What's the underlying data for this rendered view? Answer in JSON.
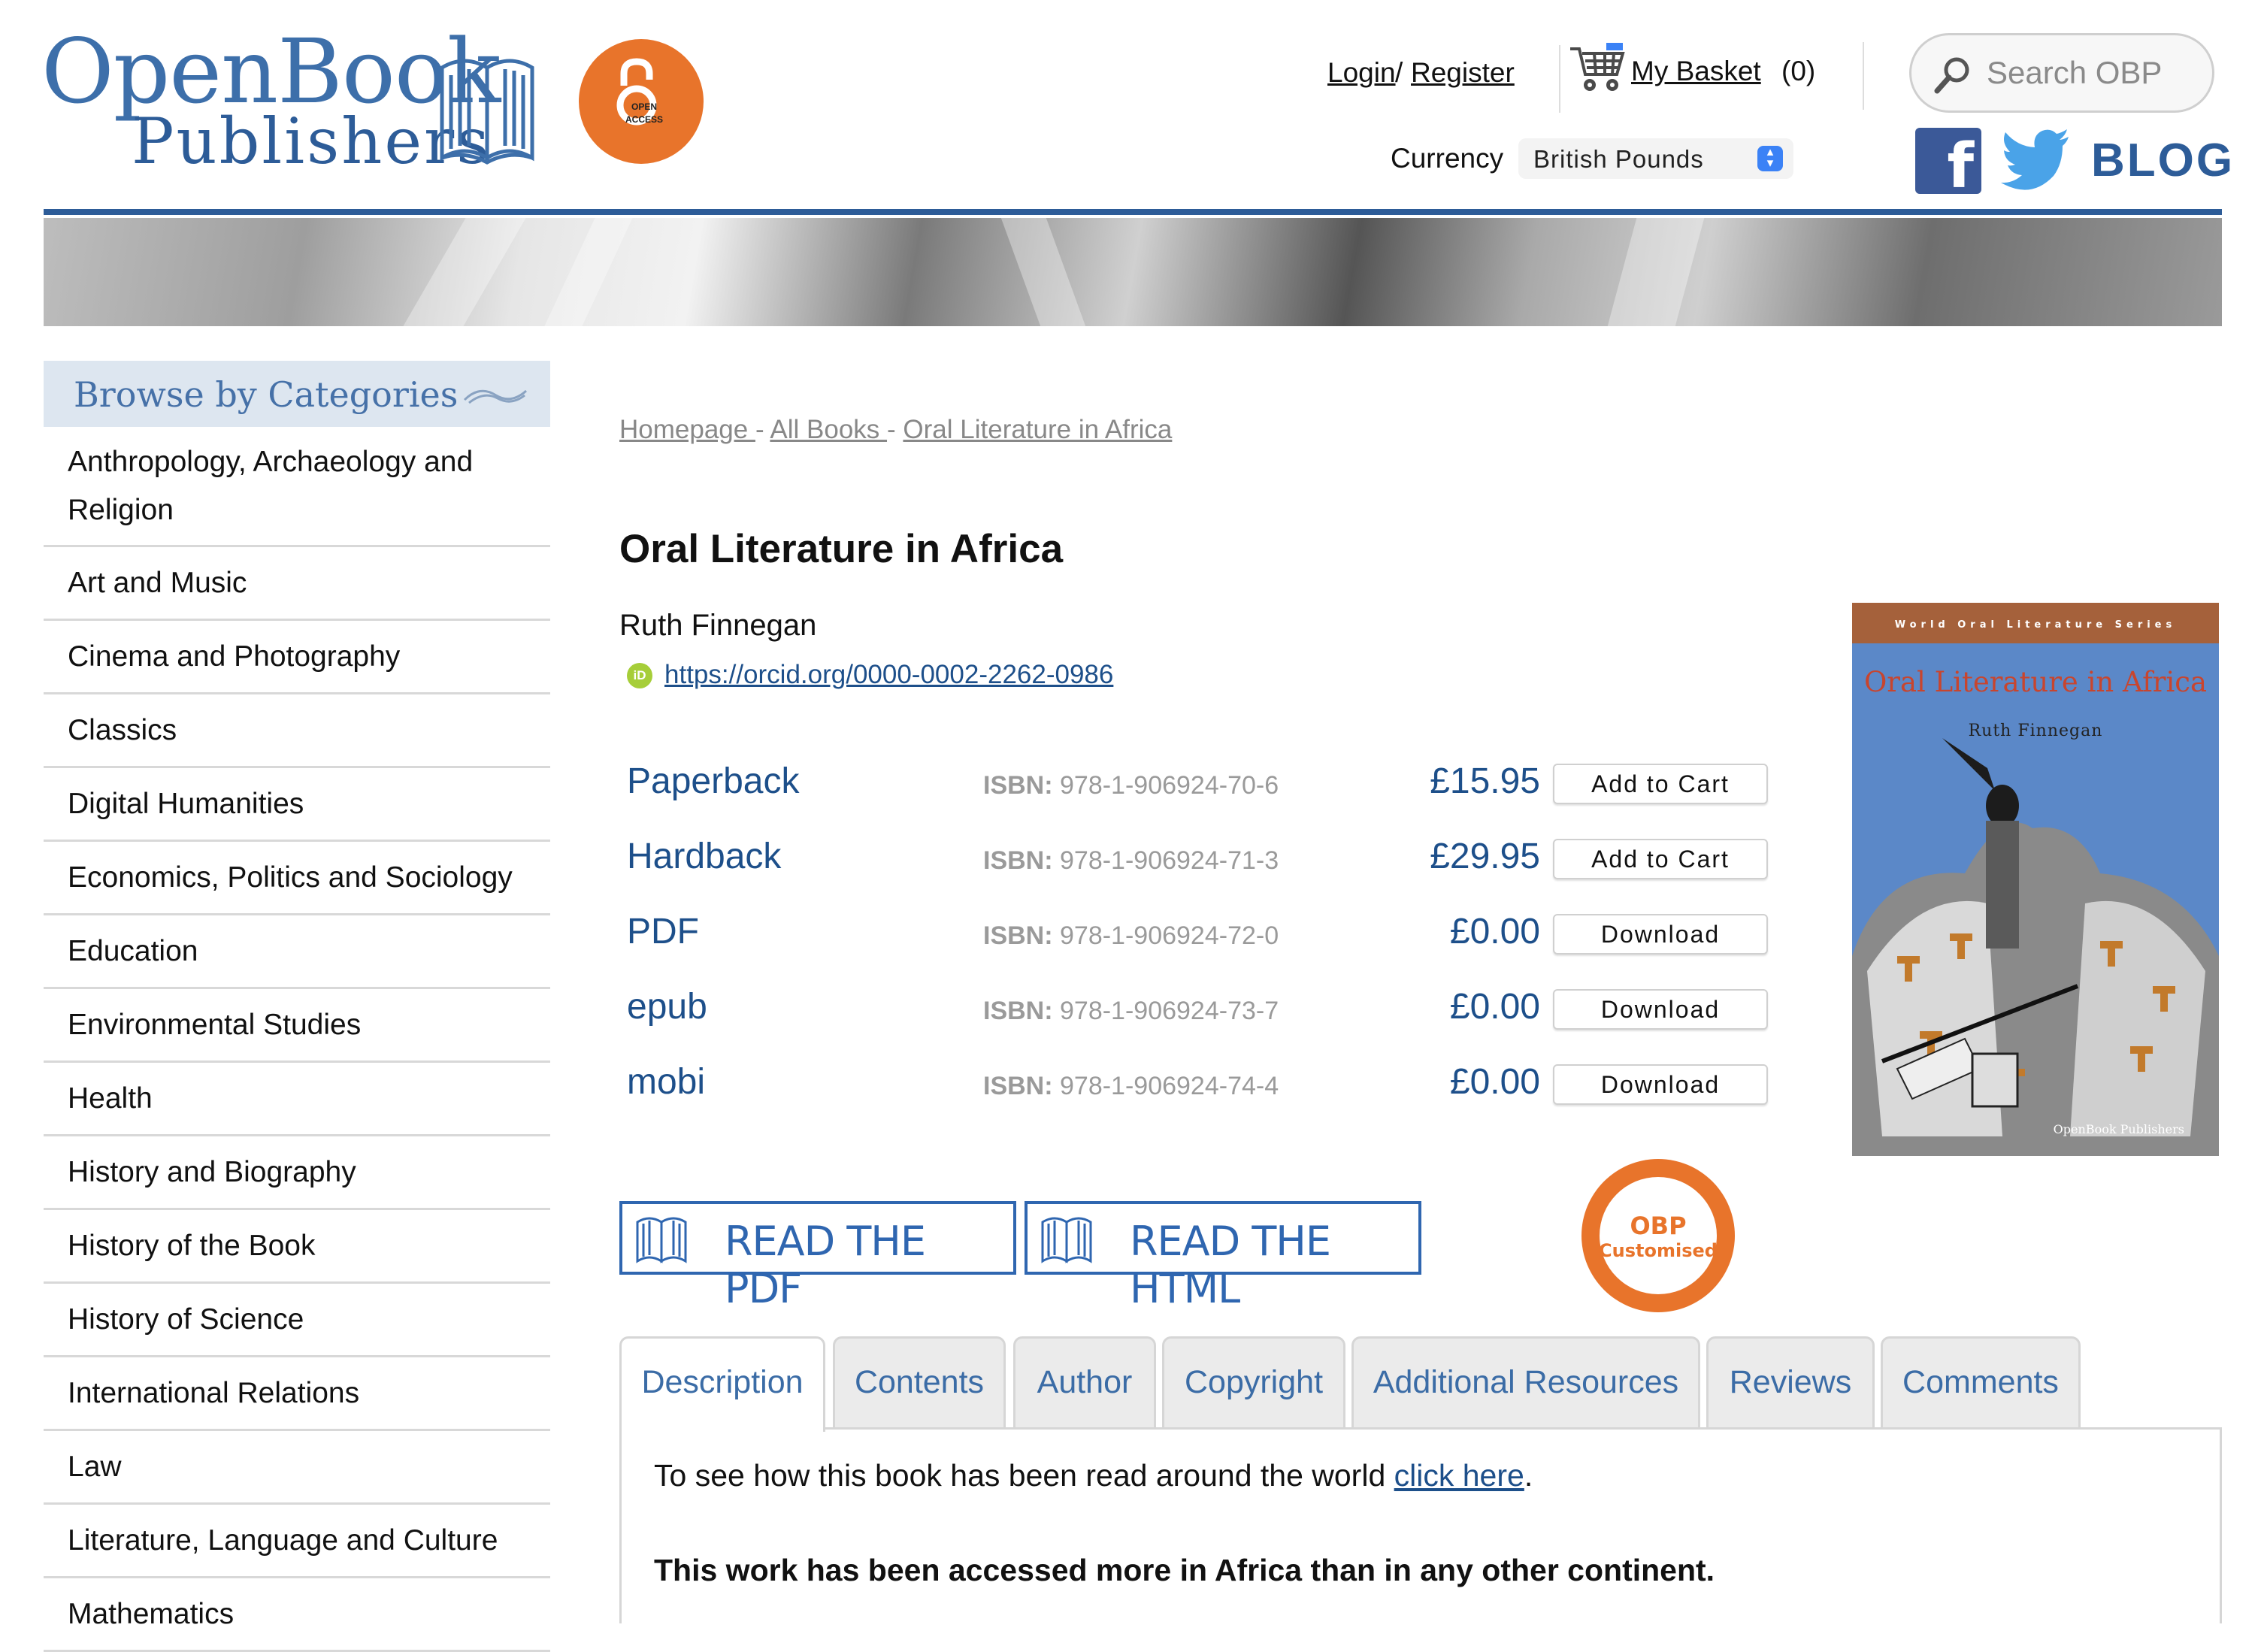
{
  "brand": {
    "name_line1": "OpenBook",
    "name_line2": "Publishers",
    "oa_badge_text_1": "OPEN",
    "oa_badge_text_2": "ACCESS"
  },
  "header": {
    "login": "Login",
    "login_sep": "/",
    "register": "Register",
    "basket_label": "My Basket",
    "basket_count": "(0)",
    "currency_label": "Currency",
    "currency_value": "British Pounds",
    "search_placeholder": "Search OBP",
    "blog_label": "BLOG"
  },
  "sidebar": {
    "title": "Browse by Categories",
    "items": [
      "Anthropology, Archaeology and Religion",
      "Art and Music",
      "Cinema and Photography",
      "Classics",
      "Digital Humanities",
      "Economics, Politics and Sociology",
      "Education",
      "Environmental Studies",
      "Health",
      "History and Biography",
      "History of the Book",
      "History of Science",
      "International Relations",
      "Law",
      "Literature, Language and Culture",
      "Mathematics"
    ]
  },
  "breadcrumb": {
    "home": "Homepage ",
    "sep1": " - ",
    "all_books": "All Books ",
    "sep2": " - ",
    "current": "Oral Literature in Africa"
  },
  "book": {
    "title": "Oral Literature in Africa",
    "author": "Ruth Finnegan",
    "orcid_icon": "iD",
    "orcid_url": "https://orcid.org/0000-0002-2262-0986",
    "formats": [
      {
        "name": "Paperback",
        "isbn_label": "ISBN:",
        "isbn": " 978-1-906924-70-6",
        "price": "£15.95",
        "action": "Add to Cart"
      },
      {
        "name": "Hardback",
        "isbn_label": "ISBN:",
        "isbn": " 978-1-906924-71-3",
        "price": "£29.95",
        "action": "Add to Cart"
      },
      {
        "name": "PDF",
        "isbn_label": "ISBN:",
        "isbn": " 978-1-906924-72-0",
        "price": "£0.00",
        "action": "Download"
      },
      {
        "name": "epub",
        "isbn_label": "ISBN:",
        "isbn": " 978-1-906924-73-7",
        "price": "£0.00",
        "action": "Download"
      },
      {
        "name": "mobi",
        "isbn_label": "ISBN:",
        "isbn": " 978-1-906924-74-4",
        "price": "£0.00",
        "action": "Download"
      }
    ],
    "cover": {
      "series": "World Oral Literature Series",
      "title": "Oral Literature in Africa",
      "author": "Ruth Finnegan",
      "publisher": "OpenBook Publishers"
    }
  },
  "actions": {
    "read_pdf": "READ THE PDF",
    "read_html": "READ THE HTML",
    "customised_1": "OBP",
    "customised_2": "Customised"
  },
  "tabs": [
    "Description",
    "Contents",
    "Author",
    "Copyright",
    "Additional Resources",
    "Reviews",
    "Comments"
  ],
  "description": {
    "line1_prefix": "To see how this book has been read around the world ",
    "line1_link": "click here",
    "line1_suffix": ".",
    "line2": "This work has been accessed more in Africa than in any other continent."
  },
  "colors": {
    "brand_blue": "#2d5c98",
    "link_blue": "#1d4f8a",
    "accent_orange": "#e8742b"
  }
}
